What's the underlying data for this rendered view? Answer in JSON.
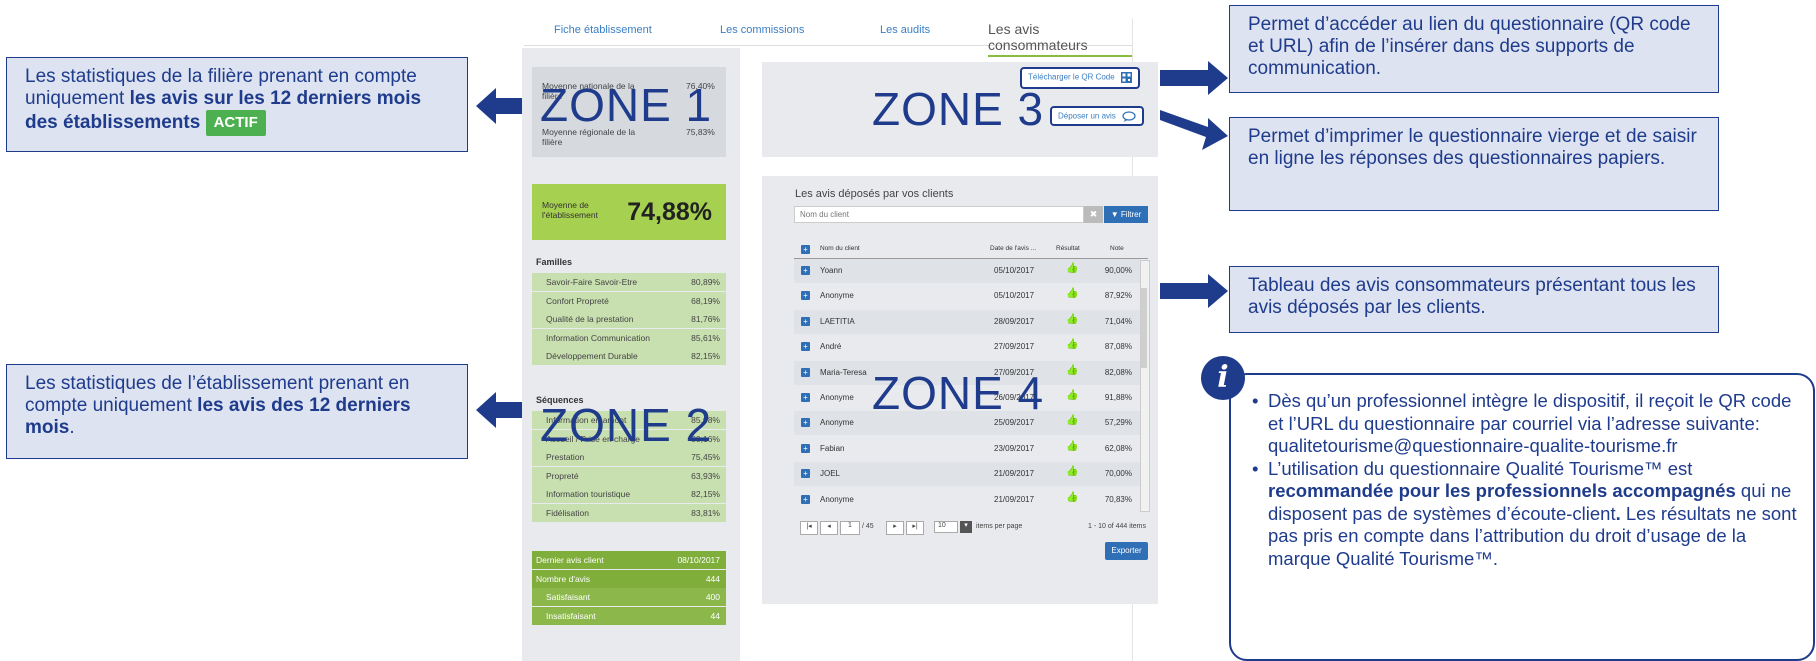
{
  "tabs": [
    {
      "label": "Fiche établissement"
    },
    {
      "label": "Les commissions"
    },
    {
      "label": "Les audits"
    },
    {
      "label": "Les avis consommateurs"
    }
  ],
  "callouts": {
    "left_top": {
      "text_before": "Les statistiques de la filière prenant en compte uniquement ",
      "bold": "les avis sur les 12 derniers mois des établissements",
      "badge": "ACTIF"
    },
    "left_bottom": {
      "text_before": "Les statistiques de l’établissement prenant en compte uniquement ",
      "bold": "les avis des 12 derniers mois",
      "text_after": "."
    },
    "right_qr": "Permet d’accéder au lien du questionnaire (QR code et URL) afin de l’insérer dans des supports de communication.",
    "right_print": "Permet d’imprimer le questionnaire vierge et de saisir en ligne les réponses des questionnaires papiers.",
    "right_table": "Tableau des avis consommateurs présentant tous les avis déposés par les clients."
  },
  "zones": {
    "z1": "ZONE 1",
    "z2": "ZONE 2",
    "z3": "ZONE 3",
    "z4": "ZONE 4"
  },
  "zone1": {
    "national_label": "Moyenne nationale de la filière",
    "national_value": "76,40%",
    "regional_label": "Moyenne régionale de la filière",
    "regional_value": "75,83%"
  },
  "establishment": {
    "label": "Moyenne de l'établissement",
    "value": "74,88%"
  },
  "familles": {
    "title": "Familles",
    "items": [
      {
        "label": "Savoir-Faire Savoir-Etre",
        "value": "80,89%"
      },
      {
        "label": "Confort Propreté",
        "value": "68,19%"
      },
      {
        "label": "Qualité de la prestation",
        "value": "81,76%"
      },
      {
        "label": "Information Communication",
        "value": "85,61%"
      },
      {
        "label": "Développement Durable",
        "value": "82,15%"
      }
    ]
  },
  "sequences": {
    "title": "Séquences",
    "items": [
      {
        "label": "Information en amont",
        "value": "85,08%"
      },
      {
        "label": "Accueil / Prise en charge",
        "value": "80,16%"
      },
      {
        "label": "Prestation",
        "value": "75,45%"
      },
      {
        "label": "Propreté",
        "value": "63,93%"
      },
      {
        "label": "Information touristique",
        "value": "82,15%"
      },
      {
        "label": "Fidélisation",
        "value": "83,81%"
      }
    ]
  },
  "summary": [
    {
      "label": "Dernier avis client",
      "value": "08/10/2017"
    },
    {
      "label": "Nombre d'avis",
      "value": "444"
    },
    {
      "label": "Satisfaisant",
      "value": "400"
    },
    {
      "label": "Insatisfaisant",
      "value": "44"
    }
  ],
  "zone3": {
    "qr_button": "Télécharger le QR Code",
    "deposit_button": "Déposer un avis"
  },
  "reviews": {
    "title": "Les avis déposés par vos clients",
    "search_placeholder": "Nom du client",
    "filter_button": "Filtrer",
    "columns": [
      "Nom du client",
      "Date de l'avis ...",
      "Résultat",
      "Note"
    ],
    "rows": [
      {
        "name": "Yoann",
        "date": "05/10/2017",
        "note": "90,00%"
      },
      {
        "name": "Anonyme",
        "date": "05/10/2017",
        "note": "87,92%"
      },
      {
        "name": "LAETITIA",
        "date": "28/09/2017",
        "note": "71,04%"
      },
      {
        "name": "André",
        "date": "27/09/2017",
        "note": "87,08%"
      },
      {
        "name": "Maria-Teresa",
        "date": "27/09/2017",
        "note": "82,08%"
      },
      {
        "name": "Anonyme",
        "date": "26/09/2017",
        "note": "91,88%"
      },
      {
        "name": "Anonyme",
        "date": "25/09/2017",
        "note": "57,29%"
      },
      {
        "name": "Fabian",
        "date": "23/09/2017",
        "note": "62,08%"
      },
      {
        "name": "JOEL",
        "date": "21/09/2017",
        "note": "70,00%"
      },
      {
        "name": "Anonyme",
        "date": "21/09/2017",
        "note": "70,83%"
      }
    ],
    "pager": {
      "page": "1",
      "of": "/ 45",
      "per_page": "10",
      "per_page_label": "items per page",
      "range": "1 - 10 of 444 items"
    },
    "export_button": "Exporter"
  },
  "info": {
    "icon": "i",
    "bullet1": "Dès qu’un professionnel intègre le dispositif, il reçoit le QR code et l’URL du questionnaire par courriel via l’adresse suivante: qualitetourisme@questionnaire-qualite-tourisme.fr",
    "bullet2_before": "L’utilisation du questionnaire Qualité Tourisme™ est ",
    "bullet2_bold": "recommandée pour les professionnels accompagnés",
    "bullet2_mid": " qui ne disposent pas de systèmes d’écoute-client",
    "bullet2_bold2": ".",
    "bullet2_after": " Les résultats ne sont pas pris en compte dans l’attribution du droit d’usage de la marque Qualité Tourisme™."
  },
  "colors": {
    "accent": "#1f3b8c",
    "green": "#a6d04f",
    "dark_green": "#7fae3b",
    "callout_bg": "#dde3f0"
  }
}
